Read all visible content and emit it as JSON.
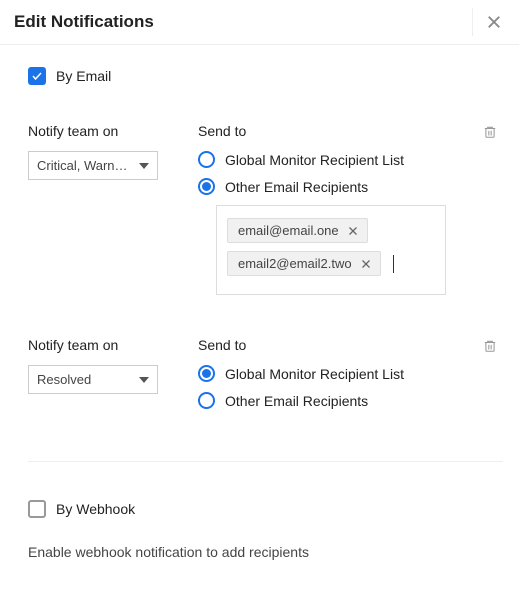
{
  "header": {
    "title": "Edit Notifications"
  },
  "emailSection": {
    "checkboxLabel": "By Email",
    "checked": true
  },
  "group1": {
    "notifyLabel": "Notify team on",
    "selectValue": "Critical, Warn…",
    "sendToLabel": "Send to",
    "optGlobal": "Global Monitor Recipient List",
    "optOther": "Other Email Recipients",
    "chips": [
      "email@email.one",
      "email2@email2.two"
    ]
  },
  "group2": {
    "notifyLabel": "Notify team on",
    "selectValue": "Resolved",
    "sendToLabel": "Send to",
    "optGlobal": "Global Monitor Recipient List",
    "optOther": "Other Email Recipients"
  },
  "webhookSection": {
    "checkboxLabel": "By Webhook",
    "checked": false,
    "helpText": "Enable webhook notification to add recipients"
  }
}
